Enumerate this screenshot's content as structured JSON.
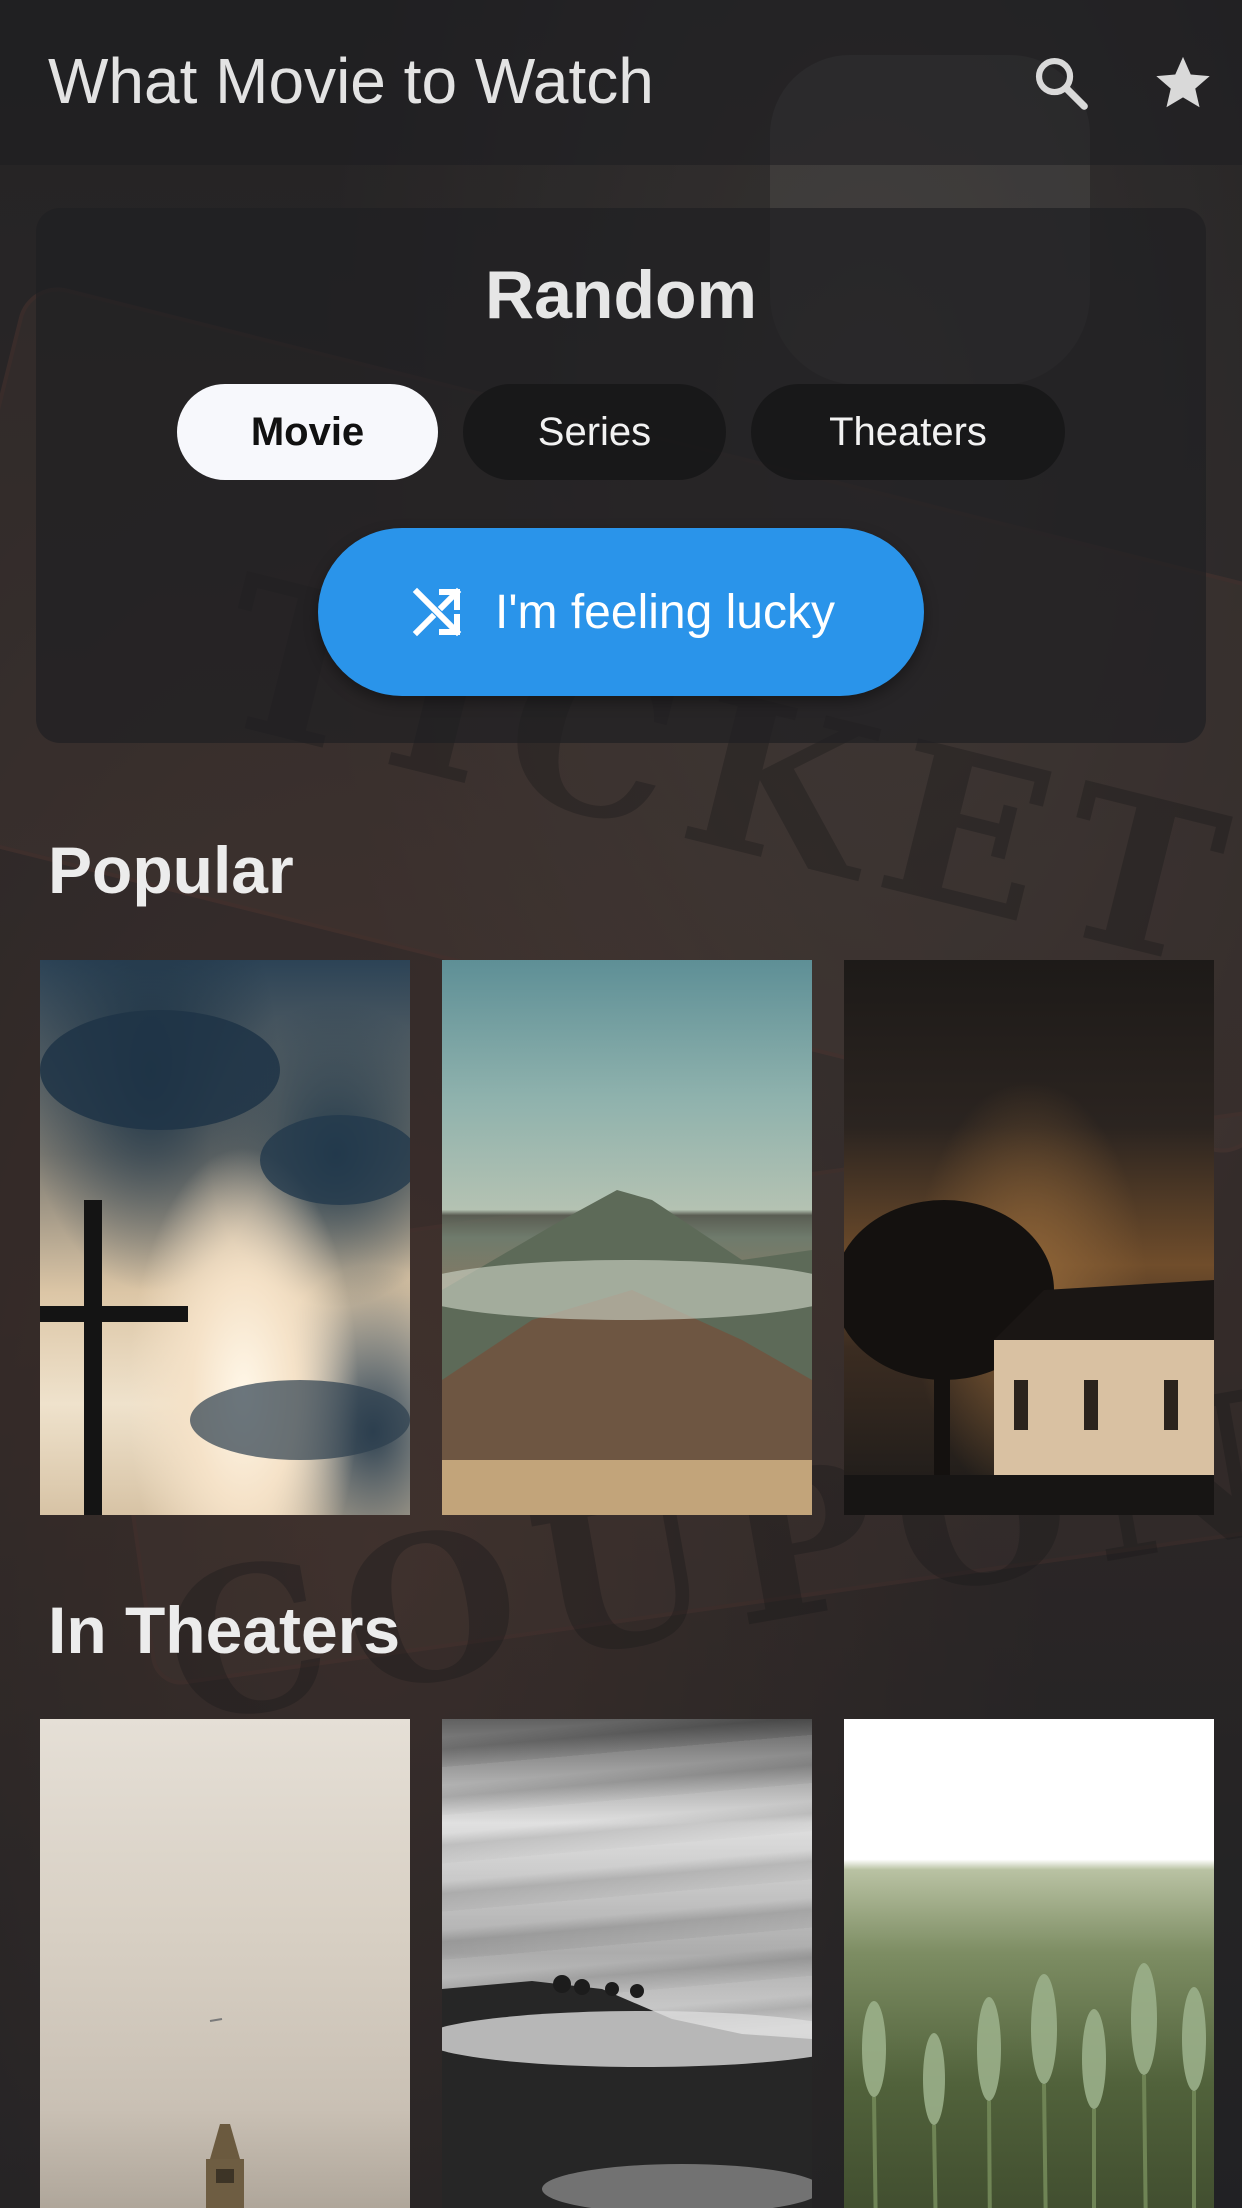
{
  "appbar": {
    "title": "What Movie to Watch",
    "search_icon": "search-icon",
    "favorites_icon": "star-icon"
  },
  "random": {
    "title": "Random",
    "chips": [
      {
        "label": "Movie",
        "selected": true
      },
      {
        "label": "Series",
        "selected": false
      },
      {
        "label": "Theaters",
        "selected": false
      }
    ],
    "lucky_button": {
      "label": "I'm feeling lucky",
      "icon": "shuffle-icon"
    }
  },
  "sections": {
    "popular": {
      "title": "Popular"
    },
    "in_theaters": {
      "title": "In Theaters"
    }
  },
  "colors": {
    "accent": "#2a94ea",
    "chip_selected_bg": "#f7f8fc",
    "chip_bg": "#161618"
  }
}
